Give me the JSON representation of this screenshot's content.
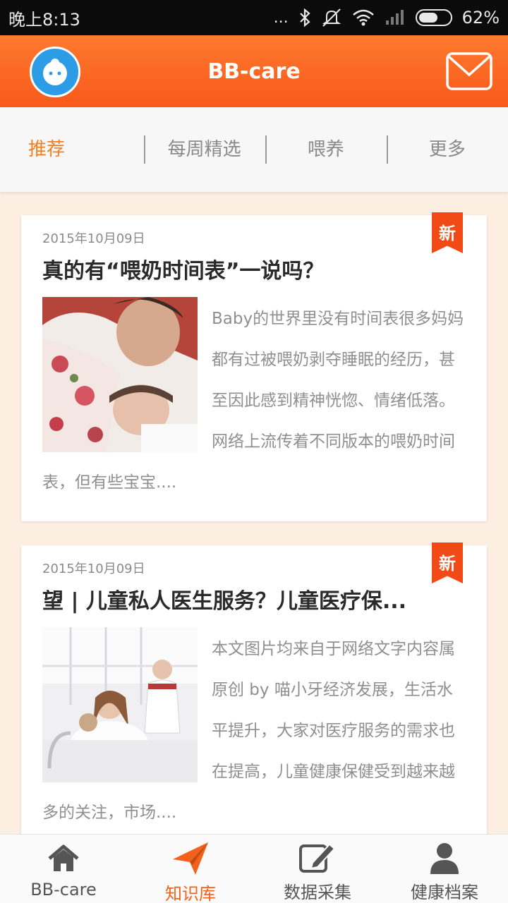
{
  "status": {
    "time": "晚上8:13",
    "dots": "...",
    "battery_percent": "62%",
    "battery_level": 0.62
  },
  "app": {
    "title": "BB-care",
    "accent_color": "#f7591a",
    "avatar_icon": "baby-face-icon",
    "mail_icon": "mail-icon"
  },
  "tabs": [
    {
      "label": "推荐",
      "active": true
    },
    {
      "label": "每周精选",
      "active": false
    },
    {
      "label": "喂养",
      "active": false
    },
    {
      "label": "更多",
      "active": false
    }
  ],
  "articles": [
    {
      "date": "2015年10月09日",
      "title": "真的有“喂奶时间表”一说吗？",
      "badge": "新",
      "excerpt": "Baby的世界里没有时间表很多妈妈都有过被喂奶剥夺睡眠的经历，甚至因此感到精神恍惚、情绪低落。网络上流传着不同版本的喂奶时间表，但有些宝宝....",
      "image": "mother-nursing-baby-photo"
    },
    {
      "date": "2015年10月09日",
      "title": "望 | 儿童私人医生服务？儿童医疗保...",
      "badge": "新",
      "excerpt": "本文图片均来自于网络文字内容属原创 by 喵小牙经济发展，生活水平提升，大家对医疗服务的需求也在提高，儿童健康保健受到越来越多的关注，市场....",
      "image": "girl-with-doctor-photo"
    }
  ],
  "bottom_nav": [
    {
      "label": "BB-care",
      "icon": "home-icon",
      "active": false
    },
    {
      "label": "知识库",
      "icon": "paper-plane-icon",
      "active": true
    },
    {
      "label": "数据采集",
      "icon": "edit-icon",
      "active": false
    },
    {
      "label": "健康档案",
      "icon": "user-icon",
      "active": false
    }
  ]
}
